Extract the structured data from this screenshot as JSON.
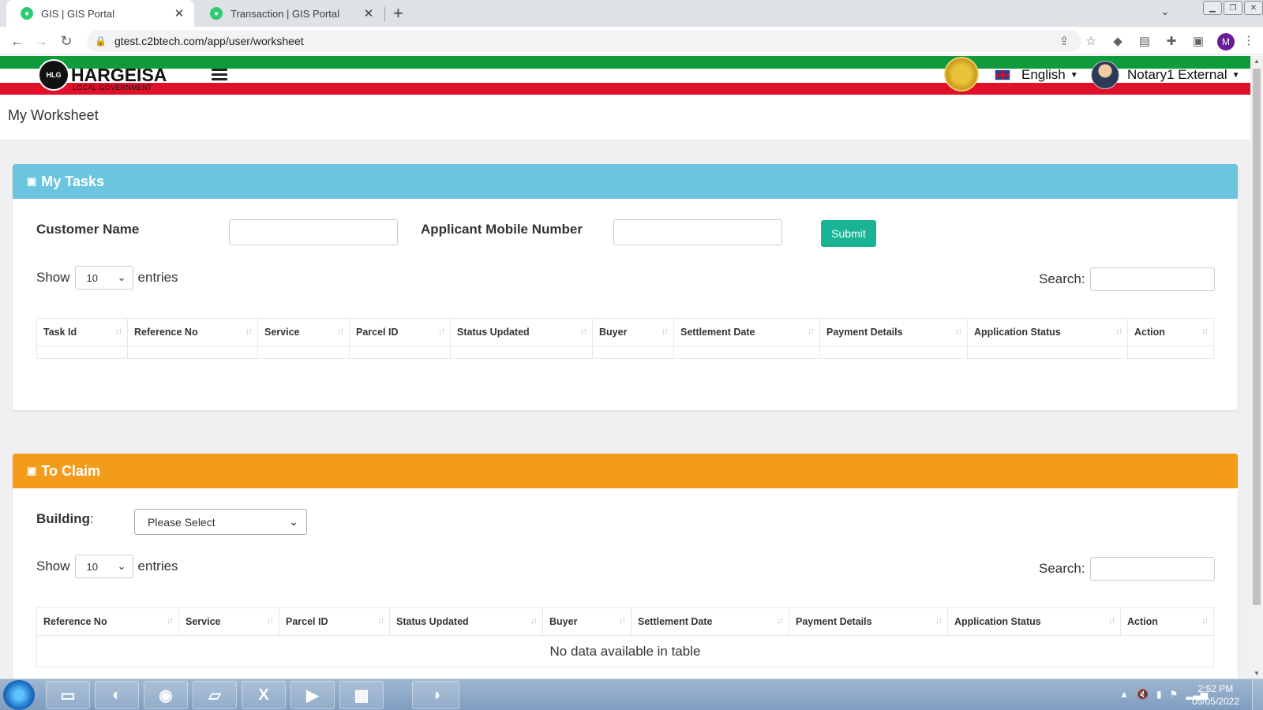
{
  "browser": {
    "tabs": [
      {
        "title": "GIS | GIS Portal"
      },
      {
        "title": "Transaction | GIS Portal"
      }
    ],
    "url": "gtest.c2btech.com/app/user/worksheet",
    "profile_initial": "M"
  },
  "header": {
    "logo_text": "HARGEISA",
    "logo_sub": "LOCAL GOVERNMENT",
    "language": "English",
    "user_name": "Notary1 External"
  },
  "page_title": "My Worksheet",
  "my_tasks": {
    "title": "My Tasks",
    "customer_name_label": "Customer Name",
    "mobile_label": "Applicant Mobile Number",
    "submit_label": "Submit",
    "show_label": "Show",
    "entries_value": "10",
    "entries_label": "entries",
    "search_label": "Search:",
    "columns": [
      "Task Id",
      "Reference No",
      "Service",
      "Parcel ID",
      "Status Updated",
      "Buyer",
      "Settlement Date",
      "Payment Details",
      "Application Status",
      "Action"
    ]
  },
  "to_claim": {
    "title": "To Claim",
    "building_label": "Building",
    "building_colon": ":",
    "building_value": "Please Select",
    "show_label": "Show",
    "entries_value": "10",
    "entries_label": "entries",
    "search_label": "Search:",
    "columns": [
      "Reference No",
      "Service",
      "Parcel ID",
      "Status Updated",
      "Buyer",
      "Settlement Date",
      "Payment Details",
      "Application Status",
      "Action"
    ],
    "empty_message": "No data available in table"
  },
  "taskbar": {
    "time": "2:52 PM",
    "date": "05/05/2022"
  },
  "colors": {
    "my_tasks_header": "#6bc5de",
    "to_claim_header": "#f39c1c",
    "submit_button": "#1ab394",
    "flag_green": "#0f9b3c",
    "flag_red": "#e0102a"
  }
}
